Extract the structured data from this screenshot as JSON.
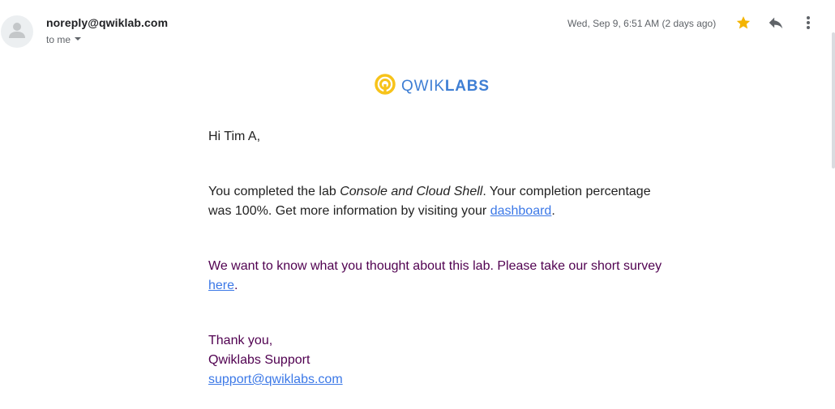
{
  "header": {
    "sender_email": "noreply@qwiklab.com",
    "recipient_label": "to me",
    "date": "Wed, Sep 9, 6:51 AM (2 days ago)",
    "icons": {
      "avatar": "person-icon",
      "recipient_dropdown": "caret-down-icon",
      "star": "star-icon",
      "reply": "reply-icon",
      "more": "more-vert-icon"
    },
    "starred": true,
    "star_color": "#f4b400"
  },
  "logo": {
    "text_light": "QWIK",
    "text_bold": "LABS",
    "icon": "qwiklabs-logo-icon",
    "colors": {
      "ring": "#f7c31a",
      "text": "#3f7fd4"
    }
  },
  "body": {
    "greeting": "Hi Tim A,",
    "p1_prefix": "You completed the lab ",
    "p1_lab_name": "Console and Cloud Shell",
    "p1_middle": ". Your completion percentage was 100%. Get more information by visiting your ",
    "p1_link": "dashboard",
    "p1_suffix": ".",
    "p2_prefix": "We want to know what you thought about this lab. Please take our short survey ",
    "p2_link": "here",
    "p2_suffix": ".",
    "thanks": "Thank you,",
    "signature": "Qwiklabs Support",
    "support_email": "support@qwiklabs.com"
  },
  "colors": {
    "link": "#3b78e7",
    "quoted_text": "#500050",
    "body_text": "#222222"
  }
}
